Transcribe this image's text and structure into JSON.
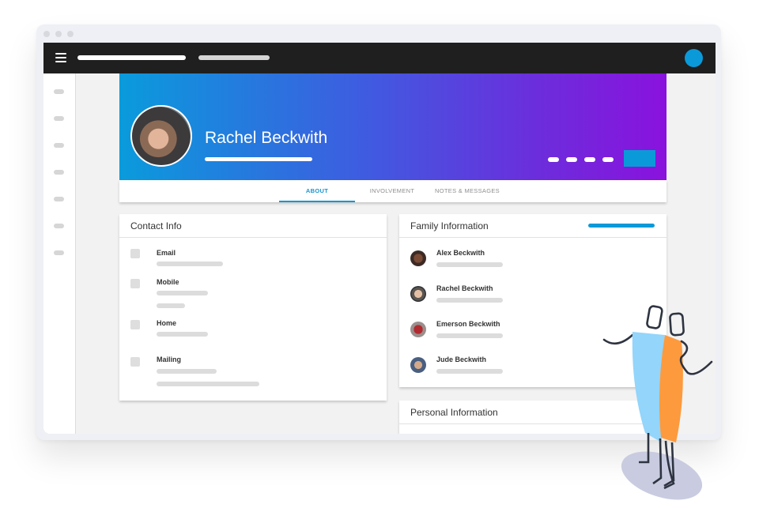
{
  "window": {
    "controls": [
      "close",
      "minimize",
      "maximize"
    ]
  },
  "topbar": {
    "menu_icon": "hamburger-icon",
    "nav_placeholders": 2,
    "user_badge_color": "#0a9ad9"
  },
  "sidebar": {
    "item_count": 7
  },
  "profile": {
    "name": "Rachel Beckwith",
    "action_dashes": 4,
    "primary_button_color": "#0a9ad9",
    "gradient": [
      "#0a9bdc",
      "#8a12dd"
    ]
  },
  "tabs": [
    {
      "label": "ABOUT",
      "active": true
    },
    {
      "label": "INVOLVEMENT",
      "active": false
    },
    {
      "label": "NOTES & MESSAGES",
      "active": false
    }
  ],
  "contact_info": {
    "title": "Contact Info",
    "fields": [
      {
        "label": "Email"
      },
      {
        "label": "Mobile"
      },
      {
        "label": "Home"
      },
      {
        "label": "Mailing"
      }
    ]
  },
  "family_info": {
    "title": "Family Information",
    "members": [
      {
        "name": "Alex Beckwith"
      },
      {
        "name": "Rachel Beckwith"
      },
      {
        "name": "Emerson Beckwith"
      },
      {
        "name": "Jude Beckwith"
      }
    ]
  },
  "personal_info": {
    "title": "Personal Information"
  },
  "colors": {
    "accent": "#1796d3",
    "figure_blue": "#93d5fb",
    "figure_orange": "#fd9a3d"
  }
}
